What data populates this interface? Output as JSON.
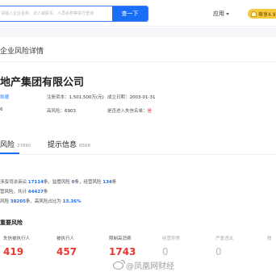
{
  "header": {
    "search_placeholder": "请输入企业名称、法人或股东、人员名称等进行查询",
    "search_button": "查一下",
    "app_menu": "应用",
    "vip_badge": "尊享4.9元"
  },
  "page": {
    "title": "企业风险详情"
  },
  "company": {
    "name": "地产集团有限公司",
    "row1": {
      "legal_rep": "凯德",
      "capital_label": "注册资本：",
      "capital_value": "1,501,500万(元)",
      "date_label": "成立日期：",
      "date_value": "2003-01-31"
    },
    "row2": {
      "prefix": "6",
      "high_risk_label": "高风险：",
      "high_risk_value": "6903",
      "dishonest_label": "是否进入失信名单：",
      "dishonest_value": "是"
    }
  },
  "tabs": [
    {
      "label": "风险",
      "count": "27860"
    },
    {
      "label": "提示信息",
      "count": "6568"
    }
  ],
  "summary": {
    "line1": {
      "prefix": "涉及司法诉讼",
      "v1": "17114",
      "t1": "条，监管风险",
      "v2": "0",
      "t2": "条，经营风险",
      "v3": "134",
      "t3": "条"
    },
    "line2": {
      "prefix": "营风险，共计",
      "v1": "44427",
      "t1": "条"
    },
    "line3": {
      "prefix": "风险",
      "v1": "38205",
      "t1": "条，高风险占比为",
      "v2": "13.36%"
    }
  },
  "important_risk": {
    "title": "重要风险",
    "items": [
      {
        "label": "失信被执行人",
        "value": "419",
        "muted": false
      },
      {
        "label": "被执行人",
        "value": "457",
        "muted": false
      },
      {
        "label": "限制高消费",
        "value": "1743",
        "muted": false
      },
      {
        "label": "经营异常",
        "value": "0",
        "muted": true
      },
      {
        "label": "严重违法",
        "value": "0",
        "muted": true
      },
      {
        "label": "税",
        "value": "",
        "muted": true
      }
    ]
  },
  "watermark": {
    "text": "@凤凰网财经"
  },
  "colors": {
    "accent": "#1a6ef5",
    "danger": "#e8382f",
    "badge": "#f7c93e"
  }
}
